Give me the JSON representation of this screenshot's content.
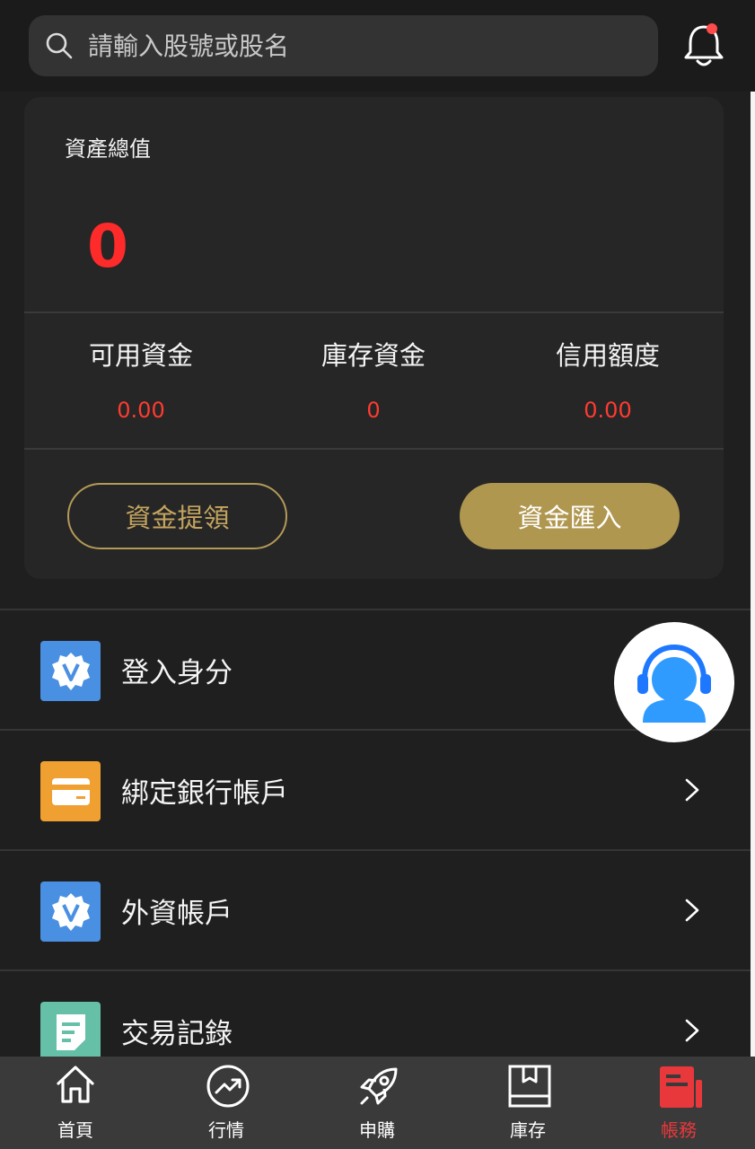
{
  "search": {
    "placeholder": "請輸入股號或股名"
  },
  "asset": {
    "title": "資產總值",
    "total": "0",
    "stats": [
      {
        "label": "可用資金",
        "value": "0.00"
      },
      {
        "label": "庫存資金",
        "value": "0"
      },
      {
        "label": "信用額度",
        "value": "0.00"
      }
    ],
    "withdraw_label": "資金提領",
    "deposit_label": "資金匯入"
  },
  "menu": [
    {
      "label": "登入身分",
      "icon": "verified-badge-icon",
      "color": "#4a90e2"
    },
    {
      "label": "綁定銀行帳戶",
      "icon": "bank-card-icon",
      "color": "#f0a030"
    },
    {
      "label": "外資帳戶",
      "icon": "verified-badge-icon",
      "color": "#4a90e2"
    },
    {
      "label": "交易記錄",
      "icon": "document-icon",
      "color": "#66c0a8"
    }
  ],
  "tabs": [
    {
      "label": "首頁",
      "icon": "home-icon"
    },
    {
      "label": "行情",
      "icon": "trend-icon"
    },
    {
      "label": "申購",
      "icon": "rocket-icon"
    },
    {
      "label": "庫存",
      "icon": "inventory-box-icon"
    },
    {
      "label": "帳務",
      "icon": "ledger-icon",
      "active": true
    }
  ],
  "colors": {
    "accent_gold": "#b0974f",
    "negative_red": "#ff2a2a",
    "active_tab": "#e8383b"
  }
}
